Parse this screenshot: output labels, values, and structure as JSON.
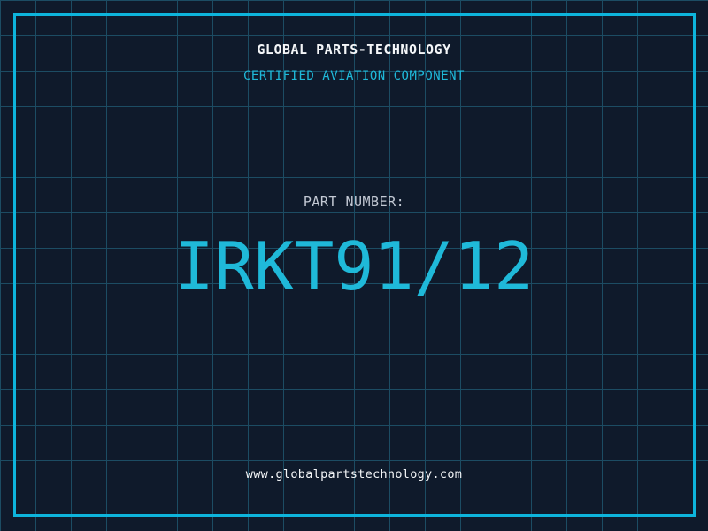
{
  "label": {
    "company": "GLOBAL PARTS-TECHNOLOGY",
    "certification": "CERTIFIED AVIATION COMPONENT",
    "part_number_label": "PART NUMBER:",
    "part_number": "IRKT91/12",
    "website": "www.globalpartstechnology.com"
  },
  "colors": {
    "background": "#0f1a2b",
    "grid_line": "#1c4c63",
    "frame_accent": "#0db4dc",
    "cyan_text": "#1fb9d9",
    "white_text": "#f4f6f8",
    "muted_text": "#c3c9d4"
  }
}
